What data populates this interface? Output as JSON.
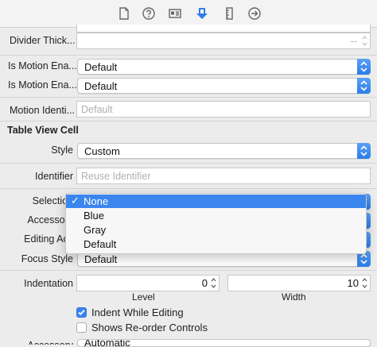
{
  "toolbar": {
    "icons": [
      "file-icon",
      "help-icon",
      "identity-icon",
      "attributes-icon",
      "ruler-icon",
      "connections-icon"
    ],
    "accent": "#3b86ee"
  },
  "rows": {
    "divider_label": "Divider Thick...",
    "divider_placeholder": "--",
    "motion1_label": "Is Motion Ena...",
    "motion1_value": "Default",
    "motion2_label": "Is Motion Ena...",
    "motion2_value": "Default",
    "motion_id_label": "Motion Identi...",
    "motion_id_placeholder": "Default"
  },
  "cell": {
    "section_title": "Table View Cell",
    "style_label": "Style",
    "style_value": "Custom",
    "identifier_label": "Identifier",
    "identifier_placeholder": "Reuse Identifier",
    "selection_label": "Selection",
    "accessory_label": "Accessory",
    "editing_label": "Editing Acc",
    "focus_label": "Focus Style",
    "focus_value": "Default",
    "indentation_label": "Indentation",
    "level_value": "0",
    "level_label": "Level",
    "width_value": "10",
    "width_label": "Width",
    "indent_editing_label": "Indent While Editing",
    "indent_editing_checked": true,
    "reorder_label": "Shows Re-order Controls",
    "reorder_checked": false,
    "accessory_type_label": "Accessory",
    "accessory_type_value": "Automatic"
  },
  "menu": {
    "items": [
      "None",
      "Blue",
      "Gray",
      "Default"
    ],
    "selected": "None"
  }
}
